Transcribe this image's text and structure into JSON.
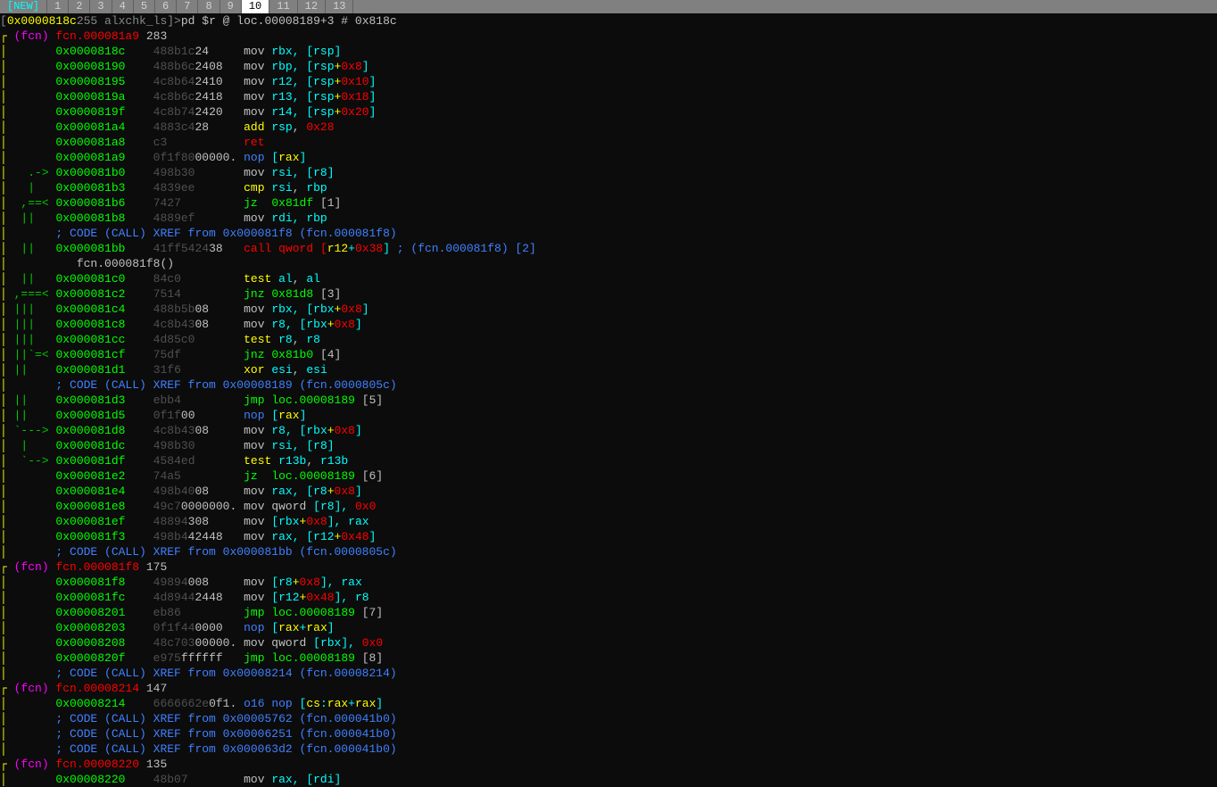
{
  "tabs": [
    "[NEW]",
    "1",
    "2",
    "3",
    "4",
    "5",
    "6",
    "7",
    "8",
    "9",
    "10",
    "11",
    "12",
    "13"
  ],
  "active_tab": 10,
  "prompt": {
    "addr": "0x0000818c",
    "info": " 255 alxchk_ls",
    "cmd": " pd $r @ loc.00008189+3 # 0x818c"
  },
  "fcn1": {
    "name": "fcn.000081a9",
    "size": "283"
  },
  "fcn2": {
    "name": "fcn.000081f8",
    "size": "175"
  },
  "fcn3": {
    "name": "fcn.00008214",
    "size": "147"
  },
  "fcn4": {
    "name": "fcn.00008220",
    "size": "135"
  },
  "fcn_sub": "fcn.000081f8()",
  "lines": [
    {
      "addr": "0x0000818c",
      "h1": "488b1c",
      "h2": "24",
      "mn": "mov",
      "a": "rbx",
      "b": ", [",
      "c": "rsp",
      "d": "]"
    },
    {
      "addr": "0x00008190",
      "h1": "488b6c",
      "h2": "2408",
      "mn": "mov",
      "a": "rbp",
      "b": ", [",
      "c": "rsp",
      "d": "+",
      "e": "0x8",
      "f": "]"
    },
    {
      "addr": "0x00008195",
      "h1": "4c8b64",
      "h2": "2410",
      "mn": "mov",
      "a": "r12",
      "b": ", [",
      "c": "rsp",
      "d": "+",
      "e": "0x10",
      "f": "]"
    },
    {
      "addr": "0x0000819a",
      "h1": "4c8b6c",
      "h2": "2418",
      "mn": "mov",
      "a": "r13",
      "b": ", [",
      "c": "rsp",
      "d": "+",
      "e": "0x18",
      "f": "]"
    },
    {
      "addr": "0x0000819f",
      "h1": "4c8b74",
      "h2": "2420",
      "mn": "mov",
      "a": "r14",
      "b": ", [",
      "c": "rsp",
      "d": "+",
      "e": "0x20",
      "f": "]"
    },
    {
      "addr": "0x000081a4",
      "h1": "4883c4",
      "h2": "28",
      "mn": "add",
      "a": "rsp",
      "b": ", ",
      "c": "0x28"
    },
    {
      "addr": "0x000081a8",
      "h1": "c3",
      "h2": "",
      "mn": "ret"
    },
    {
      "addr": "0x000081a9",
      "h1": "0f1f80",
      "h2": "00000.",
      "mn": "nop",
      "a": "[",
      "b": "rax",
      "c": "]"
    },
    {
      "addr": "0x000081b0",
      "h1": "498b30",
      "h2": "",
      "mn": "mov",
      "a": "rsi",
      "b": ", [",
      "c": "r8",
      "d": "]",
      "arrow": "┌─>"
    },
    {
      "addr": "0x000081b3",
      "h1": "4839ee",
      "h2": "",
      "mn": "cmp",
      "a": "rsi",
      "b": ", ",
      "c": "rbp",
      "arrow": "|  "
    },
    {
      "addr": "0x000081b6",
      "h1": "7427",
      "h2": "",
      "mn": "jz",
      "a": "0x81df",
      "b": " [1]",
      "arrow": "|┌─<"
    },
    {
      "addr": "0x000081b8",
      "h1": "4889ef",
      "h2": "",
      "mn": "mov",
      "a": "rdi",
      "b": ", ",
      "c": "rbp",
      "arrow": "|| "
    },
    {
      "xref": "; CODE (CALL) XREF from 0x000081f8 (fcn.000081f8)"
    },
    {
      "addr": "0x000081bb",
      "h1": "41ff5424",
      "h2": "38",
      "mn": "call",
      "a": "qword [",
      "b": "r12",
      "c": "+",
      "d": "0x38",
      "e": "]",
      "cmt": " ; (fcn.000081f8) [2]"
    },
    {
      "sub": "fcn.000081f8()"
    },
    {
      "addr": "0x000081c0",
      "h1": "84c0",
      "h2": "",
      "mn": "test",
      "a": "al",
      "b": ", ",
      "c": "al"
    },
    {
      "addr": "0x000081c2",
      "h1": "7514",
      "h2": "",
      "mn": "jnz",
      "a": "0x81d8",
      "b": " [3]",
      "arrow": "┌──<"
    },
    {
      "addr": "0x000081c4",
      "h1": "488b5b",
      "h2": "08",
      "mn": "mov",
      "a": "rbx",
      "b": ", [",
      "c": "rbx",
      "d": "+",
      "e": "0x8",
      "f": "]"
    },
    {
      "addr": "0x000081c8",
      "h1": "4c8b43",
      "h2": "08",
      "mn": "mov",
      "a": "r8",
      "b": ", [",
      "c": "rbx",
      "d": "+",
      "e": "0x8",
      "f": "]"
    },
    {
      "addr": "0x000081cc",
      "h1": "4d85c0",
      "h2": "",
      "mn": "test",
      "a": "r8",
      "b": ", ",
      "c": "r8"
    },
    {
      "addr": "0x000081cf",
      "h1": "75df",
      "h2": "",
      "mn": "jnz",
      "a": "0x81b0",
      "b": " [4]",
      "arrow": "└──<"
    },
    {
      "addr": "0x000081d1",
      "h1": "31f6",
      "h2": "",
      "mn": "xor",
      "a": "esi",
      "b": ", ",
      "c": "esi"
    },
    {
      "xref": "; CODE (CALL) XREF from 0x00008189 (fcn.0000805c)"
    },
    {
      "addr": "0x000081d3",
      "h1": "ebb4",
      "h2": "",
      "mn": "jmp",
      "a": "loc.00008189",
      "b": " [5]"
    },
    {
      "addr": "0x000081d5",
      "h1": "0f1f",
      "h2": "00",
      "mn": "nop",
      "a": "[",
      "b": "rax",
      "c": "]"
    },
    {
      "addr": "0x000081d8",
      "h1": "4c8b43",
      "h2": "08",
      "mn": "mov",
      "a": "r8",
      "b": ", [",
      "c": "rbx",
      "d": "+",
      "e": "0x8",
      "f": "]",
      "arrow": "└──>"
    },
    {
      "addr": "0x000081dc",
      "h1": "498b30",
      "h2": "",
      "mn": "mov",
      "a": "rsi",
      "b": ", [",
      "c": "r8",
      "d": "]"
    },
    {
      "addr": "0x000081df",
      "h1": "4584ed",
      "h2": "",
      "mn": "test",
      "a": "r13b",
      "b": ", ",
      "c": "r13b",
      "arrow": " └─>"
    },
    {
      "addr": "0x000081e2",
      "h1": "74a5",
      "h2": "",
      "mn": "jz",
      "a": "loc.00008189",
      "b": " [6]"
    },
    {
      "addr": "0x000081e4",
      "h1": "498b40",
      "h2": "08",
      "mn": "mov",
      "a": "rax",
      "b": ", [",
      "c": "r8",
      "d": "+",
      "e": "0x8",
      "f": "]"
    },
    {
      "addr": "0x000081e8",
      "h1": "49c7",
      "h2": "0000000.",
      "mn": "mov qword",
      "a": "[",
      "b": "r8",
      "c": "], ",
      "d": "0x0"
    },
    {
      "addr": "0x000081ef",
      "h1": "48894",
      "h2": "308",
      "mn": "mov",
      "a": "[",
      "b": "rbx",
      "c": "+",
      "d": "0x8",
      "e": "], ",
      "f": "rax"
    },
    {
      "addr": "0x000081f3",
      "h1": "498b4",
      "h2": "42448",
      "mn": "mov",
      "a": "rax",
      "b": ", [",
      "c": "r12",
      "d": "+",
      "e": "0x48",
      "f": "]"
    },
    {
      "xref": "; CODE (CALL) XREF from 0x000081bb (fcn.0000805c)"
    },
    {
      "addr": "0x000081f8",
      "h1": "49894",
      "h2": "008",
      "mn": "mov",
      "a": "[",
      "b": "r8",
      "c": "+",
      "d": "0x8",
      "e": "], ",
      "f": "rax"
    },
    {
      "addr": "0x000081fc",
      "h1": "4d8944",
      "h2": "2448",
      "mn": "mov",
      "a": "[",
      "b": "r12",
      "c": "+",
      "d": "0x48",
      "e": "], ",
      "f": "r8"
    },
    {
      "addr": "0x00008201",
      "h1": "eb86",
      "h2": "",
      "mn": "jmp",
      "a": "loc.00008189",
      "b": " [7]"
    },
    {
      "addr": "0x00008203",
      "h1": "0f1f44",
      "h2": "0000",
      "mn": "nop",
      "a": "[",
      "b": "rax",
      "c": "+",
      "d": "rax",
      "e": "]"
    },
    {
      "addr": "0x00008208",
      "h1": "48c703",
      "h2": "00000.",
      "mn": "mov qword",
      "a": "[",
      "b": "rbx",
      "c": "], ",
      "d": "0x0"
    },
    {
      "addr": "0x0000820f",
      "h1": "e975",
      "h2": "ffffff",
      "mn": "jmp",
      "a": "loc.00008189",
      "b": " [8]"
    },
    {
      "xref": "; CODE (CALL) XREF from 0x00008214 (fcn.00008214)"
    },
    {
      "addr": "0x00008214",
      "h1": "6666662e",
      "h2": "0f1.",
      "mn": "o16 nop",
      "a": "[",
      "b": "cs",
      "c": ":",
      "d": "rax",
      "e": "+",
      "f": "rax",
      "g": "]"
    },
    {
      "xref": "; CODE (CALL) XREF from 0x00005762 (fcn.000041b0)"
    },
    {
      "xref": "; CODE (CALL) XREF from 0x00006251 (fcn.000041b0)"
    },
    {
      "xref": "; CODE (CALL) XREF from 0x000063d2 (fcn.000041b0)"
    },
    {
      "addr": "0x00008220",
      "h1": "48b07",
      "h2": "",
      "mn": "mov",
      "a": "rax",
      "b": ", [",
      "c": "rdi",
      "d": "]"
    }
  ]
}
